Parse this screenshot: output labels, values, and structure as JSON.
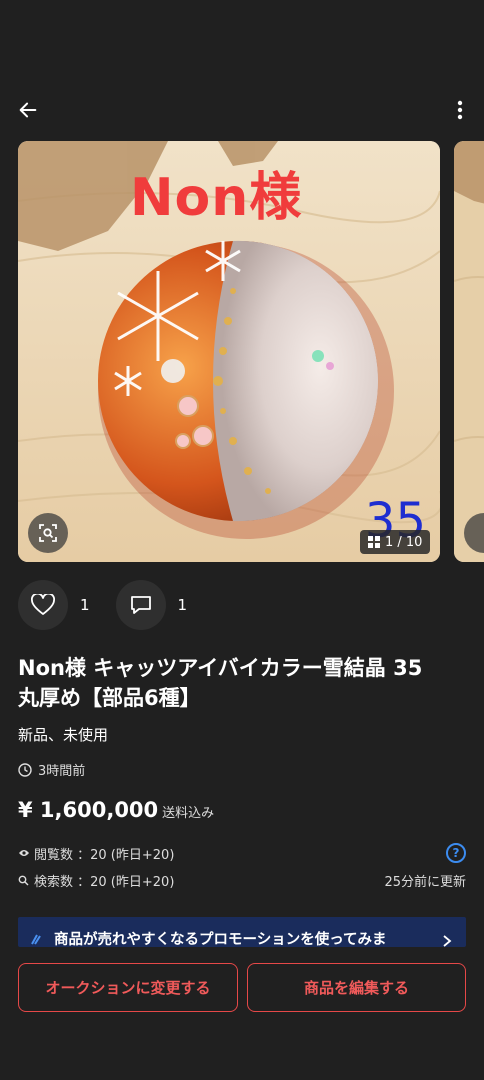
{
  "header": {
    "back_icon": "arrow-left-icon",
    "more_icon": "more-vertical-icon"
  },
  "gallery": {
    "overlay_name": "Non様",
    "overlay_number": "35",
    "counter": "1 / 10",
    "lens_icon": "image-search-icon",
    "counter_icon": "grid-icon"
  },
  "actions": {
    "like_count": "1",
    "comment_count": "1"
  },
  "item": {
    "title": "Non様 キャッツアイバイカラー雪結晶 35　丸厚め【部品6種】",
    "condition": "新品、未使用",
    "posted_time": "3時間前",
    "price": "¥ 1,600,000",
    "shipping": "送料込み"
  },
  "stats": {
    "views": "閲覧数 ：20 (昨日+20)",
    "searches": "検索数 ：20 (昨日+20)",
    "updated": "25分前に更新",
    "help_label": "?"
  },
  "promo": {
    "text": "商品が売れやすくなるプロモーションを使ってみま"
  },
  "buttons": {
    "auction": "オークションに変更する",
    "edit": "商品を編集する"
  },
  "colors": {
    "background": "#202020",
    "accent_red": "#e54848",
    "help_blue": "#3c8cf0",
    "promo_bg": "#1a2c5c"
  }
}
